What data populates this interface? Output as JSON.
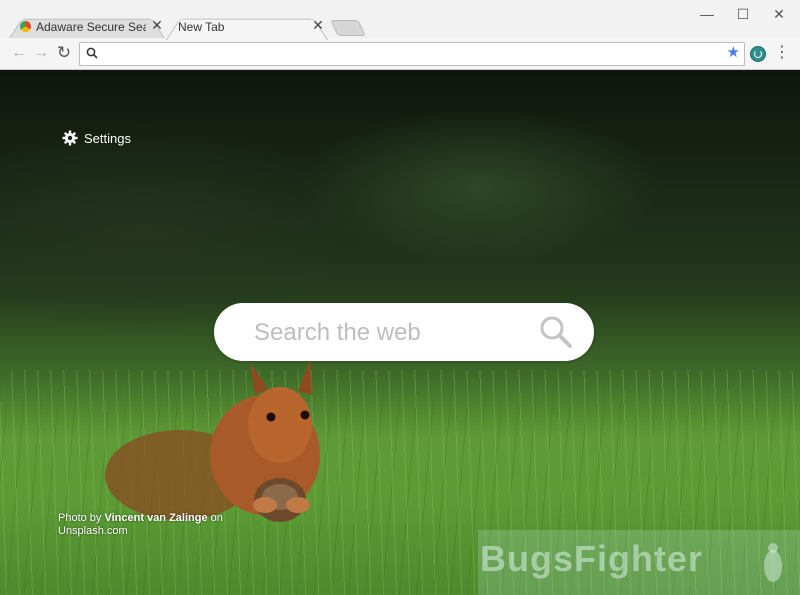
{
  "tabs": [
    {
      "title": "Adaware Secure Search -",
      "active": false
    },
    {
      "title": "New Tab",
      "active": true
    }
  ],
  "window_controls": {
    "minimize": "—",
    "maximize": "☐",
    "close": "✕"
  },
  "omnibox": {
    "value": "",
    "placeholder": ""
  },
  "page": {
    "settings_label": "Settings",
    "search_placeholder": "Search the web",
    "credit_prefix": "Photo by ",
    "credit_author": "Vincent van Zalinge",
    "credit_mid": " on",
    "credit_site": "Unsplash.com",
    "watermark": "BugsFighter"
  },
  "colors": {
    "accent_star": "#4a7ee6",
    "extension": "#2e8f8c"
  }
}
